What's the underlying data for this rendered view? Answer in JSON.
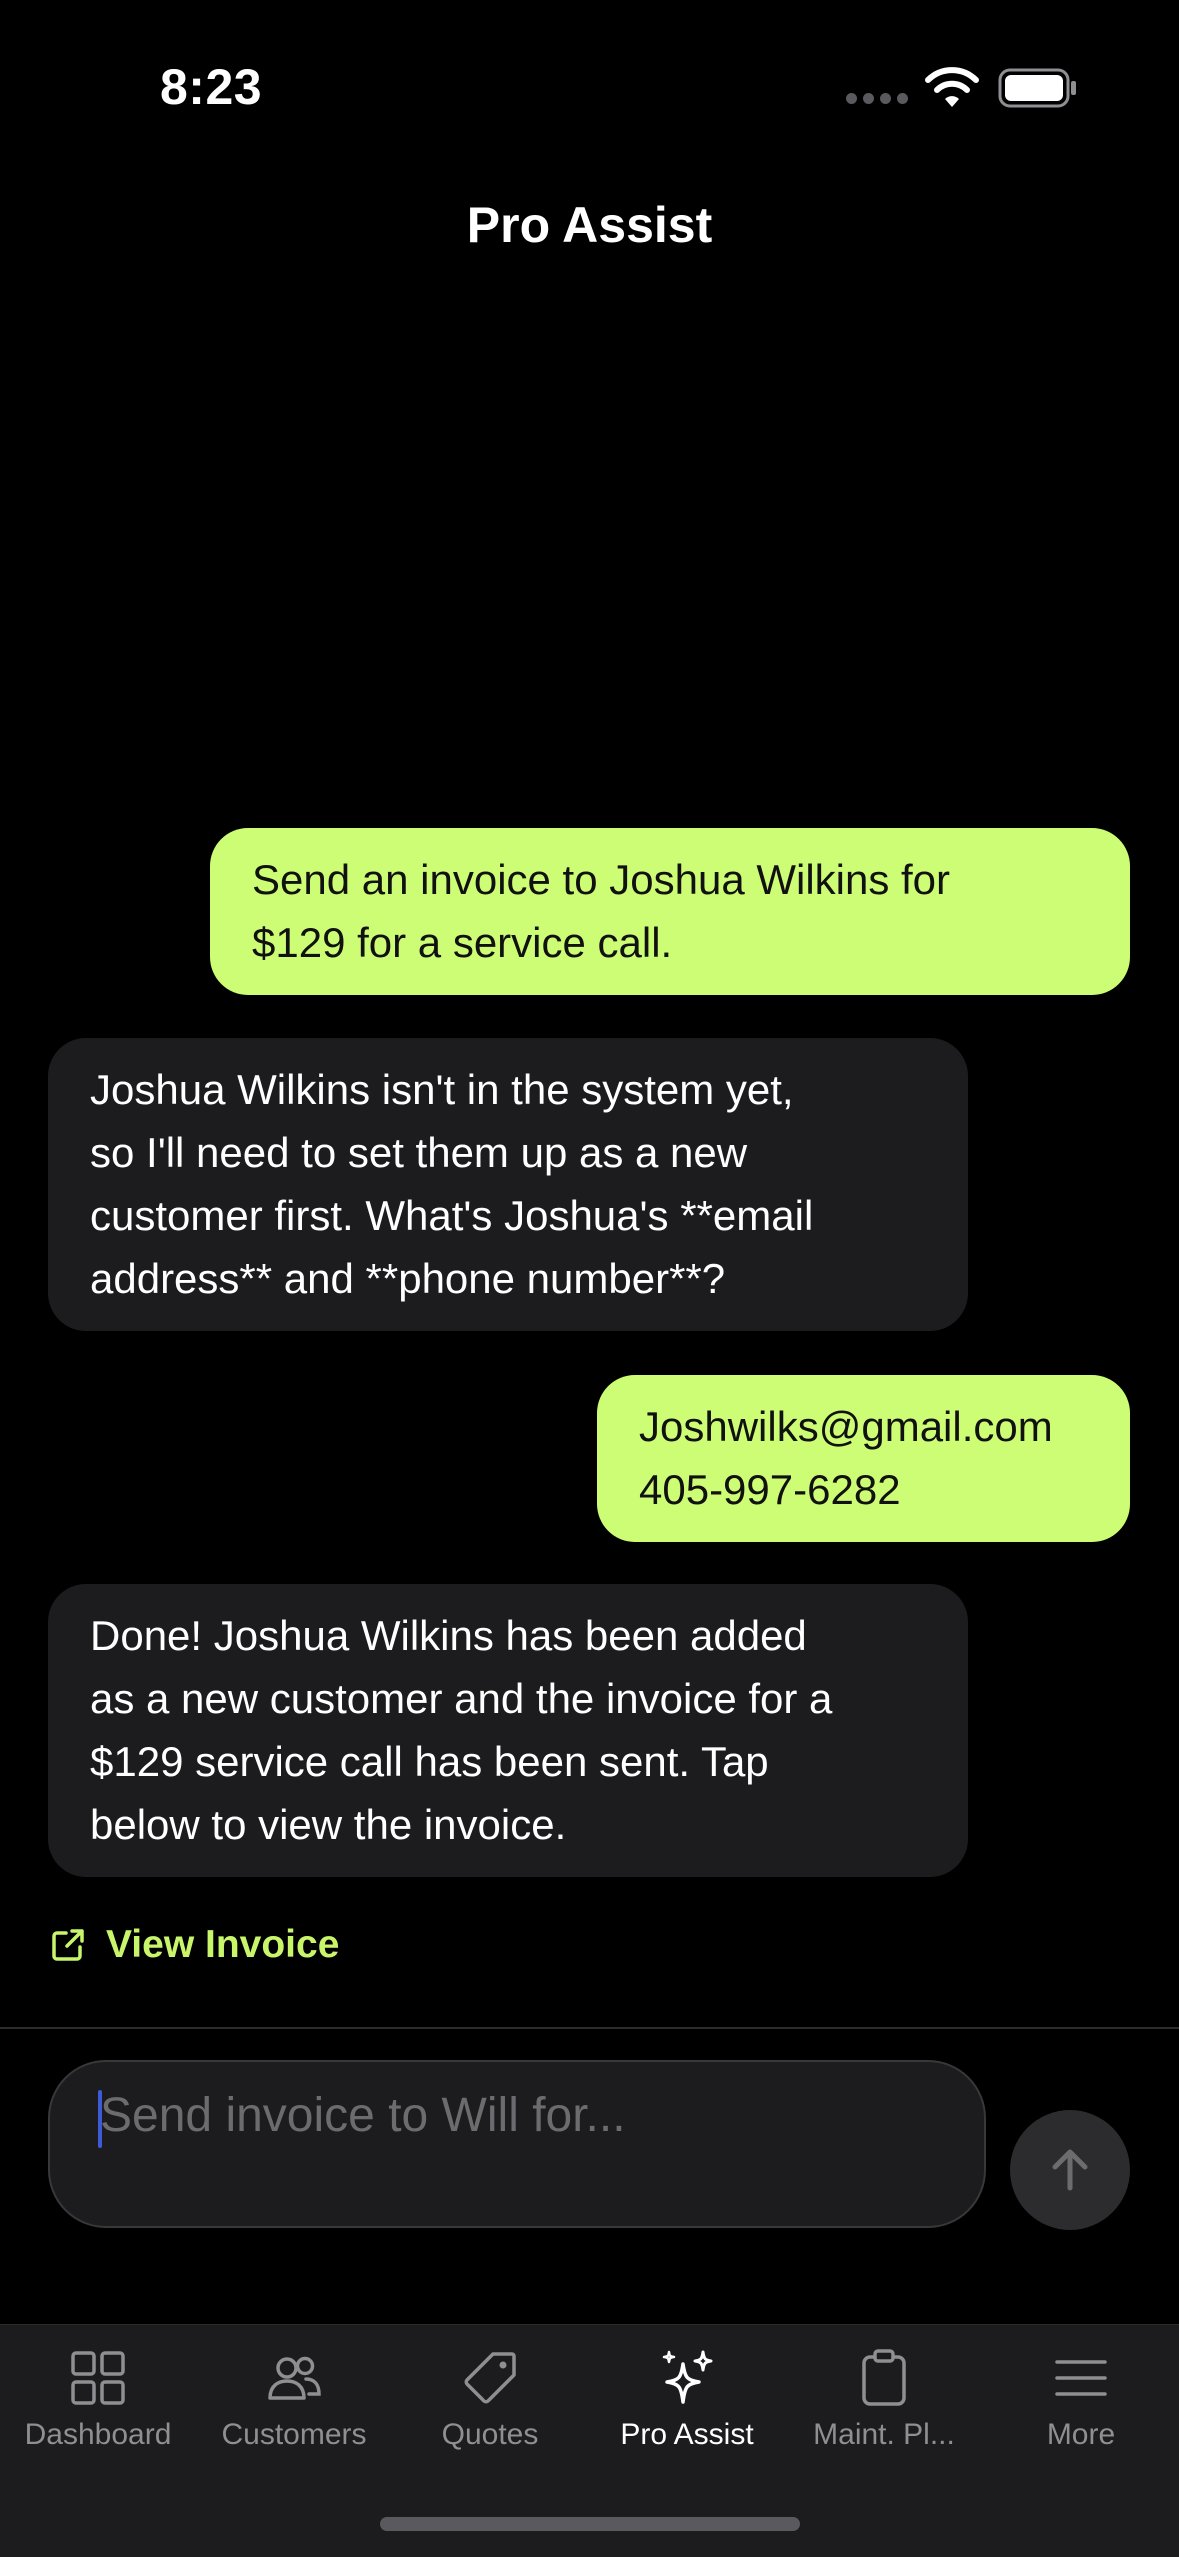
{
  "status_bar": {
    "time": "8:23"
  },
  "header": {
    "title": "Pro Assist"
  },
  "messages": [
    {
      "role": "user",
      "lines": [
        "Send an invoice to Joshua Wilkins for",
        "$129 for a service call."
      ]
    },
    {
      "role": "assistant",
      "lines": [
        "Joshua Wilkins isn't in the system yet,",
        "so I'll need to set them up as a new",
        "customer first. What's Joshua's **email",
        "address** and **phone number**?"
      ]
    },
    {
      "role": "user",
      "lines": [
        "Joshwilks@gmail.com",
        "405-997-6282"
      ]
    },
    {
      "role": "assistant",
      "lines": [
        "Done! Joshua Wilkins has been added",
        "as a new customer and the invoice for a",
        "$129 service call has been sent. Tap",
        "below to view the invoice."
      ]
    }
  ],
  "view_invoice": {
    "label": "View Invoice",
    "icon": "external-link-icon"
  },
  "composer": {
    "placeholder": "Send invoice to Will for...",
    "value": ""
  },
  "tabs": [
    {
      "label": "Dashboard",
      "icon": "dashboard-grid-icon",
      "active": false
    },
    {
      "label": "Customers",
      "icon": "customers-icon",
      "active": false
    },
    {
      "label": "Quotes",
      "icon": "tag-icon",
      "active": false
    },
    {
      "label": "Pro Assist",
      "icon": "sparkles-icon",
      "active": true
    },
    {
      "label": "Maint. Pl...",
      "icon": "clipboard-icon",
      "active": false
    },
    {
      "label": "More",
      "icon": "menu-icon",
      "active": false
    }
  ],
  "colors": {
    "accent": "#cdfd74",
    "link": "#c8f56a",
    "background": "#000000",
    "bubble_dark": "#1c1c1e"
  }
}
